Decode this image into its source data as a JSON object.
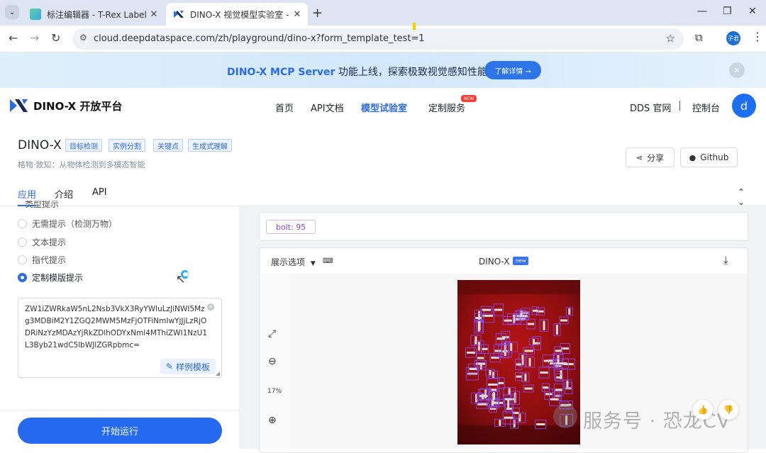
{
  "browser": {
    "tabs": [
      {
        "title": "标注编辑器 - T-Rex Label",
        "active": false
      },
      {
        "title": "DINO-X 视觉模型实验室 - DINO",
        "active": true
      }
    ],
    "url": "cloud.deepdataspace.com/zh/playground/dino-x?form_template_test=1",
    "profile_label": "子君"
  },
  "banner": {
    "highlight": "DINO-X MCP Server",
    "text": " 功能上线，探索极致视觉感知性能",
    "cta": "了解详情 →"
  },
  "header": {
    "brand": "DINO-X 开放平台",
    "nav": [
      "首页",
      "API文档",
      "模型试验室",
      "定制服务"
    ],
    "active_nav": "模型试验室",
    "nav_badge": "NEW",
    "dds": "DDS 官网",
    "console": "控制台",
    "avatar": "d"
  },
  "product": {
    "title": "DINO-X",
    "tags": [
      "目标检测",
      "实例分割",
      "关键点",
      "生成式理解"
    ],
    "subtitle": "格物·致知：从物体检测到多模态智能",
    "share": "分享",
    "github": "Github"
  },
  "content_tabs": [
    "应用",
    "介绍",
    "API"
  ],
  "left": {
    "section_title": "类型提示",
    "prompt_options": [
      "无需提示（检测万物）",
      "文本提示",
      "指代提示",
      "定制模版提示"
    ],
    "selected_option": "定制模版提示",
    "template_value": "ZW1iZWRkaW5nL2Nsb3VkX3RyYWluLzJiNWI5Mzg3MDBiM2Y1ZGQ2MWM5MzFjOTFiNmIwYjJjLzRjODRiNzYzMDAzYjRkZDlhODYxNml4MThiZWI1NzU1L3Byb21wdC5lbWJlZGRpbmc=",
    "sample_button": "样例模板",
    "run_button": "开始运行"
  },
  "result": {
    "label_chip": "bolt: 95",
    "options_label": "展示选项",
    "model_name": "DINO-X",
    "model_badge": "new",
    "zoom": "17%"
  },
  "watermark": "服务号 · 恐龙CV",
  "colors": {
    "accent": "#2c6be0",
    "run_button": "#2469ee",
    "chip_purple": "#8d46c8",
    "detection_box": "#8a4dff"
  }
}
